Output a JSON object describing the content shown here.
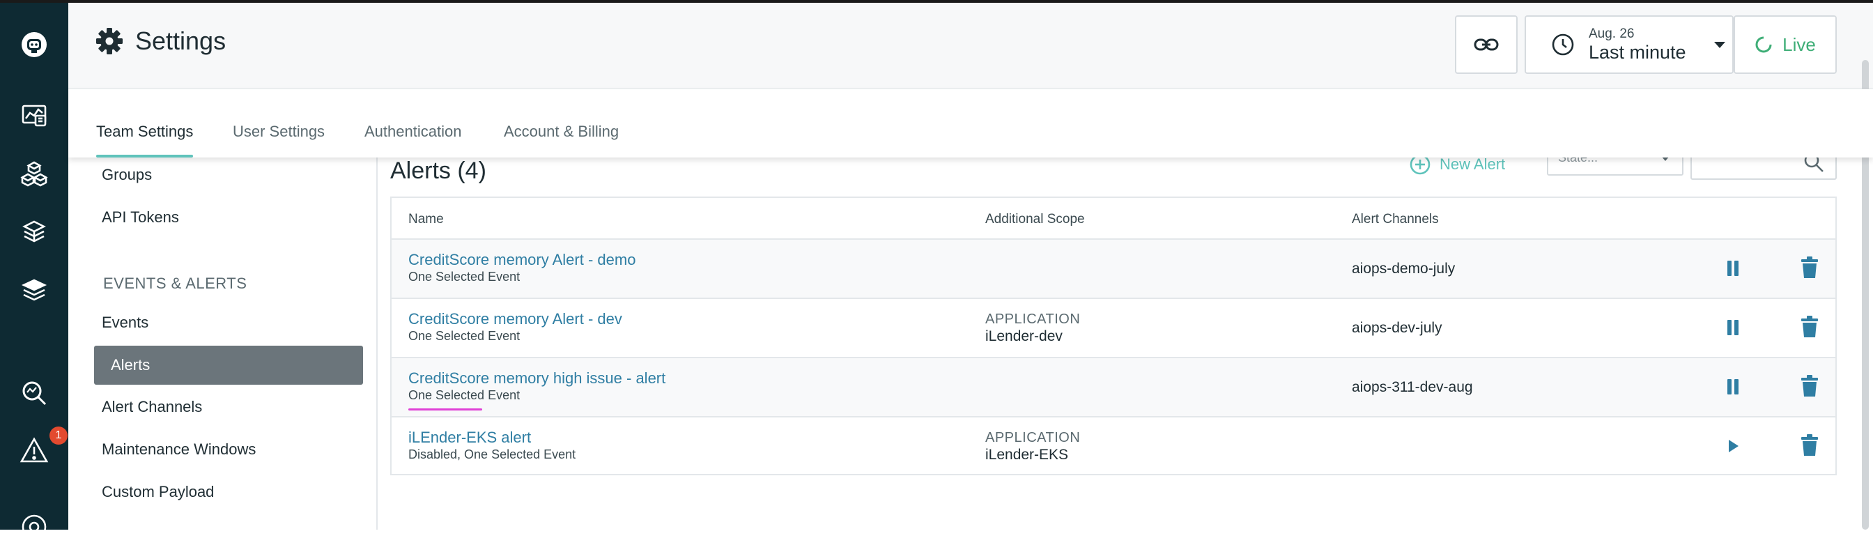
{
  "header": {
    "title": "Settings",
    "time_range": {
      "date": "Aug. 26",
      "label": "Last minute"
    },
    "live_label": "Live"
  },
  "rail": {
    "alert_badge": "1"
  },
  "tabs": [
    {
      "label": "Team Settings",
      "active": true
    },
    {
      "label": "User Settings",
      "active": false
    },
    {
      "label": "Authentication",
      "active": false
    },
    {
      "label": "Account & Billing",
      "active": false
    }
  ],
  "settings_nav": {
    "top_items": [
      "Groups",
      "API Tokens"
    ],
    "section": "EVENTS & ALERTS",
    "items": [
      "Events",
      "Alerts",
      "Alert Channels",
      "Maintenance Windows",
      "Custom Payload"
    ],
    "active": "Alerts"
  },
  "alerts": {
    "title": "Alerts (4)",
    "new_alert_label": "New Alert",
    "state_placeholder": "State...",
    "columns": {
      "name": "Name",
      "scope": "Additional Scope",
      "channels": "Alert Channels"
    },
    "rows": [
      {
        "name": "CreditScore memory Alert - demo",
        "sub": "One Selected Event",
        "scope_type": "",
        "scope_value": "",
        "channel": "aiops-demo-july",
        "action": "pause"
      },
      {
        "name": "CreditScore memory Alert - dev",
        "sub": "One Selected Event",
        "scope_type": "APPLICATION",
        "scope_value": "iLender-dev",
        "channel": "aiops-dev-july",
        "action": "pause"
      },
      {
        "name": "CreditScore memory high issue - alert",
        "sub": "One Selected Event",
        "scope_type": "",
        "scope_value": "",
        "channel": "aiops-311-dev-aug",
        "action": "pause"
      },
      {
        "name": "iLEnder-EKS alert",
        "sub": "Disabled, One Selected Event",
        "scope_type": "APPLICATION",
        "scope_value": "iLender-EKS",
        "channel": "",
        "action": "play"
      }
    ]
  },
  "colors": {
    "rail_bg": "#0e2a33",
    "accent_teal": "#5fc3bb",
    "link_blue": "#2f7ea3",
    "live_green": "#3fae77",
    "active_nav_bg": "#6b757b",
    "badge_red": "#e34a2f"
  }
}
